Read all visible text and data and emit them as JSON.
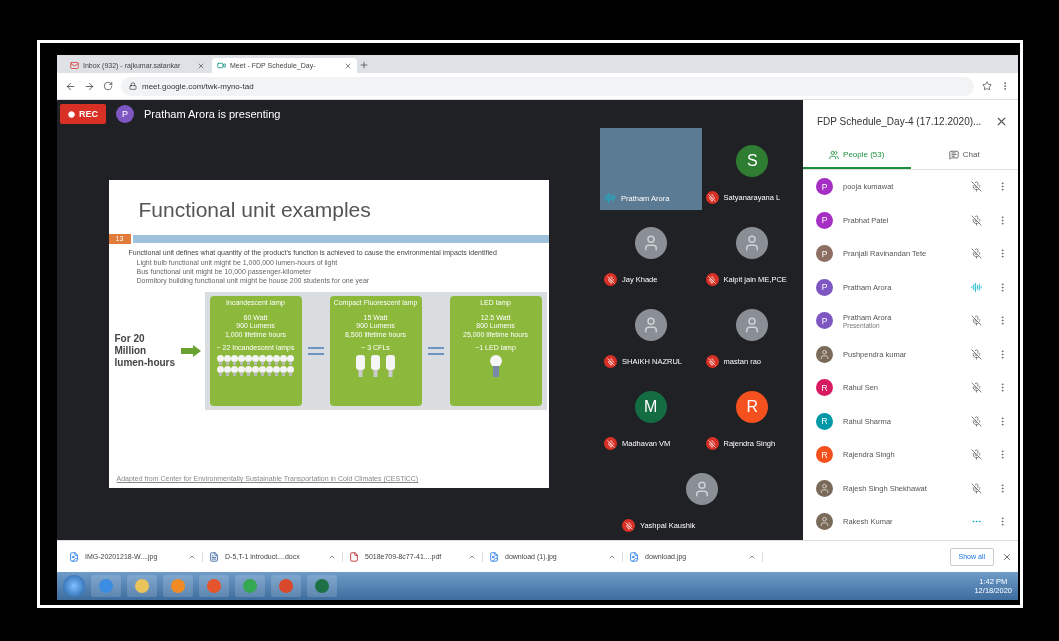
{
  "browser": {
    "tabs": [
      {
        "label": "Inbox (932) - rajkumar.satankar",
        "kind": "mail",
        "selected": false
      },
      {
        "label": "Meet - FDP Schedule_Day-",
        "kind": "meet",
        "selected": true
      }
    ],
    "url": "meet.google.com/twk-myno-tad"
  },
  "meeting": {
    "rec": "REC",
    "presenter_initial": "P",
    "presenter_text": "Pratham Arora is presenting"
  },
  "slide": {
    "title": "Functional unit examples",
    "number": "13",
    "intro": "Functional unit defines what quantity of the product's function is achieved to cause the environmental impacts identified",
    "bullets": [
      "Light bulb functional unit might be 1,000,000 lumen-hours of light",
      "Bus functional unit might be 10,000 passenger-kilometer",
      "Dormitory building functional unit might be house 200 students for one year"
    ],
    "lead": "For 20 Million lumen-hours",
    "lamps": [
      {
        "heading": "Incandescent lamp",
        "specs": [
          "60 Watt",
          "900 Lumens",
          "1,000 lifetime hours"
        ],
        "count": "~ 22 Incandescent lamps",
        "kind": "incandescent"
      },
      {
        "heading": "Compact Fluorescent lamp",
        "specs": [
          "15 Watt",
          "900 Lumens",
          "8,500 lifetime hours"
        ],
        "count": "~ 3 CFLs",
        "kind": "cfl"
      },
      {
        "heading": "LED lamp",
        "specs": [
          "12.5 Watt",
          "800 Lumens",
          "25,000 lifetime hours"
        ],
        "count": "~1 LED lamp",
        "kind": "led"
      }
    ],
    "source": "Adapted from Center for Environmentally Sustainable Transportation in Cold Climates (CESTiCC)"
  },
  "tiles": [
    {
      "name": "Pratham Arora",
      "kind": "video",
      "speaking": true
    },
    {
      "name": "Satyanarayana L",
      "kind": "letter",
      "letter": "S",
      "color": "#2e7d32",
      "speaking": false
    },
    {
      "name": "Jay Khade",
      "kind": "photo",
      "speaking": false
    },
    {
      "name": "Kalpit jain ME,PCE",
      "kind": "photo",
      "speaking": false
    },
    {
      "name": "SHAIKH NAZRUL",
      "kind": "photo",
      "speaking": false
    },
    {
      "name": "mastan rao",
      "kind": "photo",
      "speaking": false
    },
    {
      "name": "Madhavan VM",
      "kind": "letter",
      "letter": "M",
      "color": "#146c43",
      "speaking": false
    },
    {
      "name": "Rajendra Singh",
      "kind": "letter",
      "letter": "R",
      "color": "#f4511e",
      "speaking": false
    },
    {
      "name": "Yashpal Kaushik",
      "kind": "photo",
      "speaking": false
    }
  ],
  "panel": {
    "title": "FDP Schedule_Day-4 (17.12.2020)...",
    "tabs": [
      {
        "label": "People (53)",
        "kind": "people",
        "selected": true
      },
      {
        "label": "Chat",
        "kind": "chat",
        "selected": false
      }
    ],
    "people": [
      {
        "name": "pooja kumawat",
        "kind": "letter",
        "letter": "P",
        "color": "#a52fc4",
        "muted": true,
        "speaking": false
      },
      {
        "name": "Prabhat Patel",
        "kind": "letter",
        "letter": "P",
        "color": "#a52fc4",
        "muted": true,
        "speaking": false
      },
      {
        "name": "Pranjali Ravinandan Tete",
        "kind": "letter",
        "letter": "P",
        "color": "#8d6e63",
        "muted": true,
        "speaking": false
      },
      {
        "name": "Pratham Arora",
        "kind": "letter",
        "letter": "P",
        "color": "#7e57c2",
        "muted": false,
        "speaking": true
      },
      {
        "name": "Pratham Arora",
        "sub": "Presentation",
        "kind": "letter",
        "letter": "P",
        "color": "#7e57c2",
        "muted": true,
        "speaking": false
      },
      {
        "name": "Pushpendra kumar",
        "kind": "photo",
        "muted": true,
        "speaking": false
      },
      {
        "name": "Rahul Sen",
        "kind": "letter",
        "letter": "R",
        "color": "#d81b60",
        "muted": true,
        "speaking": false
      },
      {
        "name": "Rahul Sharma",
        "kind": "letter",
        "letter": "R",
        "color": "#0097a7",
        "muted": true,
        "speaking": false
      },
      {
        "name": "Rajendra Singh",
        "kind": "letter",
        "letter": "R",
        "color": "#f4511e",
        "muted": true,
        "speaking": false
      },
      {
        "name": "Rajesh Singh Shekhawat",
        "kind": "photo",
        "muted": true,
        "speaking": false
      },
      {
        "name": "Rakesh Kumar",
        "kind": "photo",
        "muted": false,
        "speaking": false
      }
    ]
  },
  "downloads": {
    "items": [
      {
        "name": "IMG-20201218-W....jpg",
        "kind": "image"
      },
      {
        "name": "D-5,T-1 introduct....docx",
        "kind": "doc"
      },
      {
        "name": "5018e709-8c77-41....pdf",
        "kind": "pdf"
      },
      {
        "name": "download (1).jpg",
        "kind": "image"
      },
      {
        "name": "download.jpg",
        "kind": "image"
      }
    ],
    "show_all": "Show all"
  },
  "taskbar": {
    "time": "1:42 PM",
    "date": "12/18/2020"
  }
}
